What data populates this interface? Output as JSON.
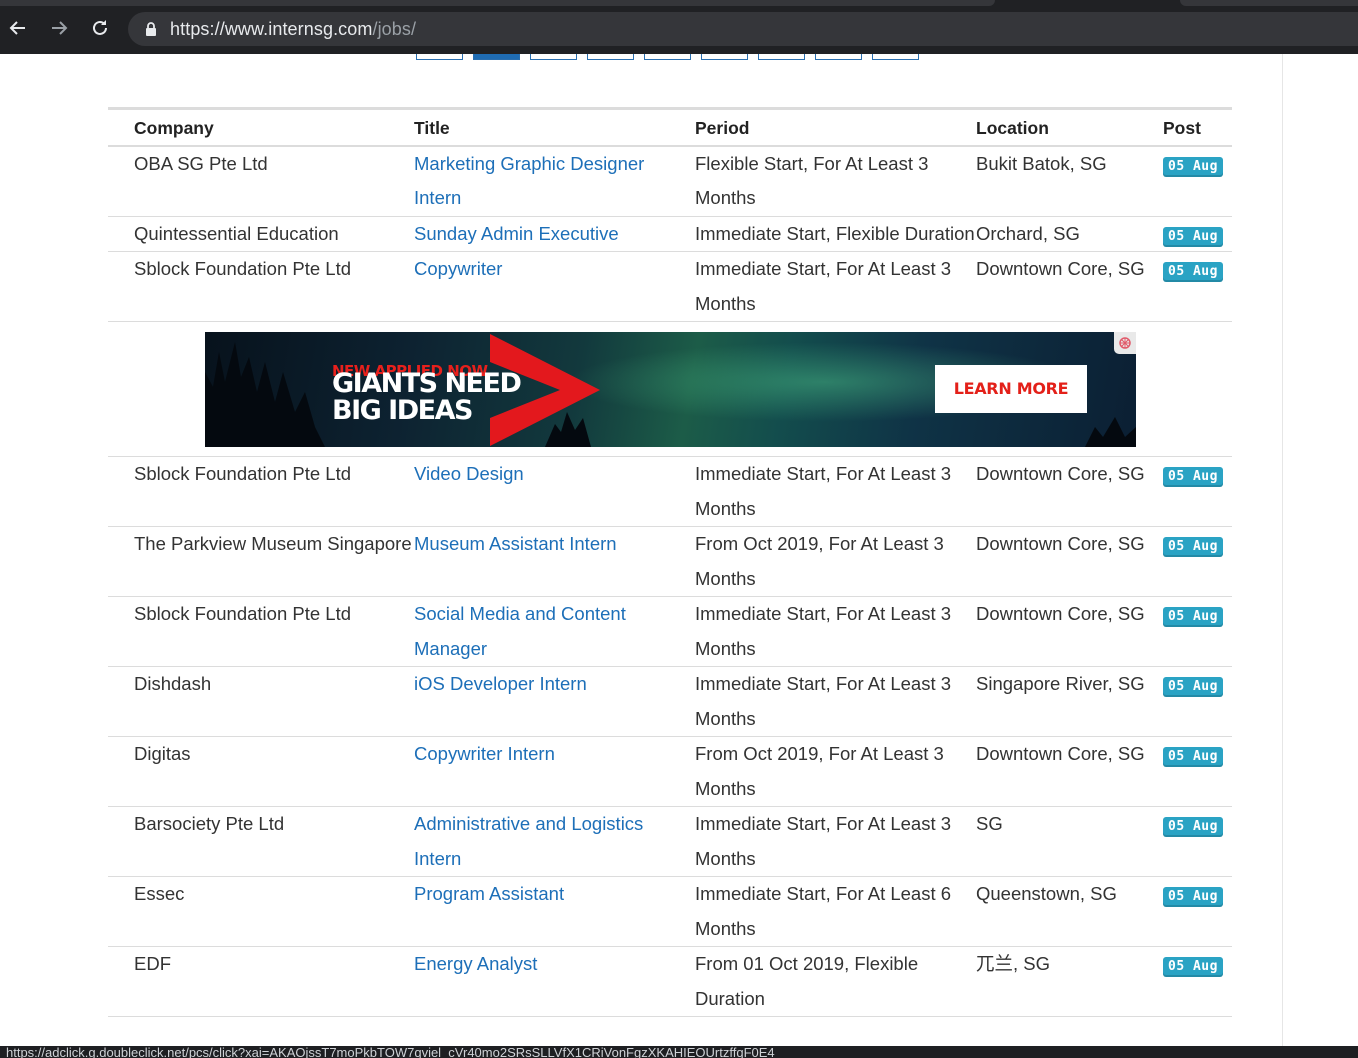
{
  "browser": {
    "url_host": "https://www.internsg.com",
    "url_path": "/jobs/",
    "status_url": "https://adclick.g.doubleclick.net/pcs/click?xai=AKAOjssT7moPkbTOW7qviel_cVr40mo2SRsSLLVfX1CRiVonFgzXKAHIEOUrtzffqF0E4"
  },
  "table": {
    "headers": {
      "company": "Company",
      "title": "Title",
      "period": "Period",
      "location": "Location",
      "post": "Post"
    },
    "rows_top": [
      {
        "company": "OBA SG Pte Ltd",
        "title": "Marketing Graphic Designer Intern",
        "period": "Flexible Start, For At Least 3 Months",
        "location": "Bukit Batok, SG",
        "post": "05 Aug"
      },
      {
        "company": "Quintessential Education",
        "title": "Sunday Admin Executive",
        "period": "Immediate Start, Flexible Duration",
        "location": "Orchard, SG",
        "post": "05 Aug"
      },
      {
        "company": "Sblock Foundation Pte Ltd",
        "title": "Copywriter",
        "period": "Immediate Start, For At Least 3 Months",
        "location": "Downtown Core, SG",
        "post": "05 Aug"
      }
    ],
    "rows_bottom": [
      {
        "company": "Sblock Foundation Pte Ltd",
        "title": "Video Design",
        "period": "Immediate Start, For At Least 3 Months",
        "location": "Downtown Core, SG",
        "post": "05 Aug"
      },
      {
        "company": "The Parkview Museum Singapore",
        "title": "Museum Assistant Intern",
        "period": "From Oct 2019, For At Least 3 Months",
        "location": "Downtown Core, SG",
        "post": "05 Aug"
      },
      {
        "company": "Sblock Foundation Pte Ltd",
        "title": "Social Media and Content Manager",
        "period": "Immediate Start, For At Least 3 Months",
        "location": "Downtown Core, SG",
        "post": "05 Aug"
      },
      {
        "company": "Dishdash",
        "title": "iOS Developer Intern",
        "period": "Immediate Start, For At Least 3 Months",
        "location": "Singapore River, SG",
        "post": "05 Aug"
      },
      {
        "company": "Digitas",
        "title": "Copywriter Intern",
        "period": "From Oct 2019, For At Least 3 Months",
        "location": "Downtown Core, SG",
        "post": "05 Aug"
      },
      {
        "company": "Barsociety Pte Ltd",
        "title": "Administrative and Logistics Intern",
        "period": "Immediate Start, For At Least 3 Months",
        "location": "SG",
        "post": "05 Aug"
      },
      {
        "company": "Essec",
        "title": "Program Assistant",
        "period": "Immediate Start, For At Least 6 Months",
        "location": "Queenstown, SG",
        "post": "05 Aug"
      },
      {
        "company": "EDF",
        "title": "Energy Analyst",
        "period": "From 01 Oct 2019, Flexible Duration",
        "location": "兀兰, SG",
        "post": "05 Aug"
      }
    ]
  },
  "ad": {
    "kicker": "NEW APPLIED NOW",
    "headline_line1": "GIANTS NEED",
    "headline_line2": "BIG IDEAS",
    "cta": "LEARN MORE"
  },
  "colors": {
    "link": "#1d6fb8",
    "badge": "#2aa3c4",
    "ad_red": "#e32019"
  }
}
